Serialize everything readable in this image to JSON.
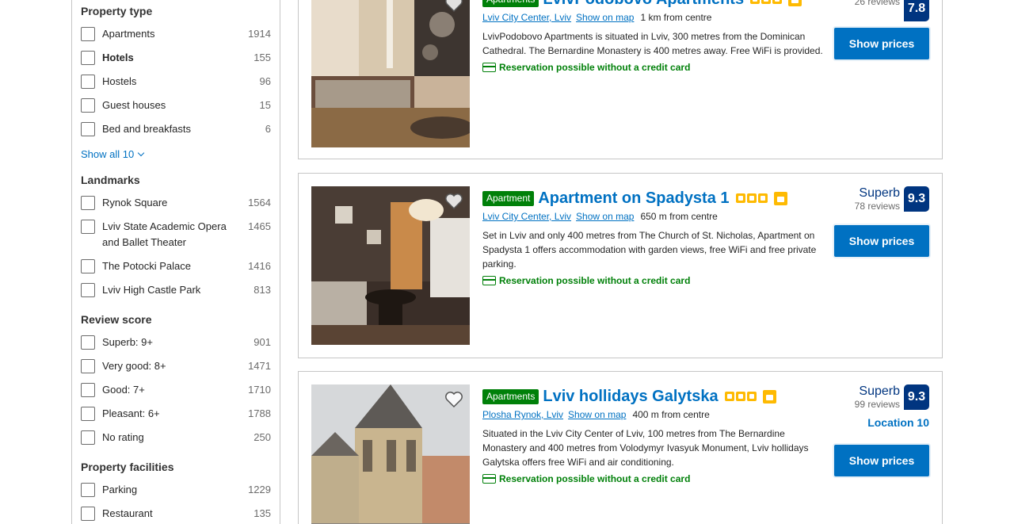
{
  "sidebar": {
    "property_type": {
      "title": "Property type",
      "items": [
        {
          "label": "Apartments",
          "count": "1914"
        },
        {
          "label": "Hotels",
          "count": "155"
        },
        {
          "label": "Hostels",
          "count": "96"
        },
        {
          "label": "Guest houses",
          "count": "15"
        },
        {
          "label": "Bed and breakfasts",
          "count": "6"
        }
      ],
      "show_all": "Show all 10"
    },
    "landmarks": {
      "title": "Landmarks",
      "items": [
        {
          "label": "Rynok Square",
          "count": "1564"
        },
        {
          "label": "Lviv State Academic Opera and Ballet Theater",
          "count": "1465"
        },
        {
          "label": "The Potocki Palace",
          "count": "1416"
        },
        {
          "label": "Lviv High Castle Park",
          "count": "813"
        }
      ]
    },
    "review_score": {
      "title": "Review score",
      "items": [
        {
          "label": "Superb: 9+",
          "count": "901"
        },
        {
          "label": "Very good: 8+",
          "count": "1471"
        },
        {
          "label": "Good: 7+",
          "count": "1710"
        },
        {
          "label": "Pleasant: 6+",
          "count": "1788"
        },
        {
          "label": "No rating",
          "count": "250"
        }
      ]
    },
    "facilities": {
      "title": "Property facilities",
      "items": [
        {
          "label": "Parking",
          "count": "1229"
        },
        {
          "label": "Restaurant",
          "count": "135"
        }
      ]
    }
  },
  "results": [
    {
      "badge": "Apartments",
      "name": "LvivPodobovo Apartments",
      "location": "Lviv City Center, Lviv",
      "show_on_map": "Show on map",
      "distance": "1 km from centre",
      "description": "LvivPodobovo Apartments is situated in Lviv, 300 metres from the Dominican Cathedral. The Bernardine Monastery is 400 metres away. Free WiFi is provided.",
      "reservation": "Reservation possible without a credit card",
      "score_label": "",
      "reviews": "26 reviews",
      "score": "7.8",
      "location_score": "",
      "button": "Show prices",
      "stars": 3
    },
    {
      "badge": "Apartment",
      "name": "Apartment on Spadysta 1",
      "location": "Lviv City Center, Lviv",
      "show_on_map": "Show on map",
      "distance": "650 m from centre",
      "description": "Set in Lviv and only 400 metres from The Church of St. Nicholas, Apartment on Spadysta 1 offers accommodation with garden views, free WiFi and free private parking.",
      "reservation": "Reservation possible without a credit card",
      "score_label": "Superb",
      "reviews": "78 reviews",
      "score": "9.3",
      "location_score": "",
      "button": "Show prices",
      "stars": 3
    },
    {
      "badge": "Apartments",
      "name": "Lviv hollidays Galytska",
      "location": "Plosha Rynok, Lviv",
      "show_on_map": "Show on map",
      "distance": "400 m from centre",
      "description": "Situated in the Lviv City Center of Lviv, 100 metres from The Bernardine Monastery and 400 metres from Volodymyr Ivasyuk Monument, Lviv hollidays Galytska offers free WiFi and air conditioning.",
      "reservation": "Reservation possible without a credit card",
      "score_label": "Superb",
      "reviews": "99 reviews",
      "score": "9.3",
      "location_score": "Location 10",
      "button": "Show prices",
      "stars": 3
    }
  ],
  "colors": {
    "link_blue": "#0071c2",
    "brand_dark": "#003580",
    "green": "#008009",
    "star_yellow": "#feba02"
  }
}
